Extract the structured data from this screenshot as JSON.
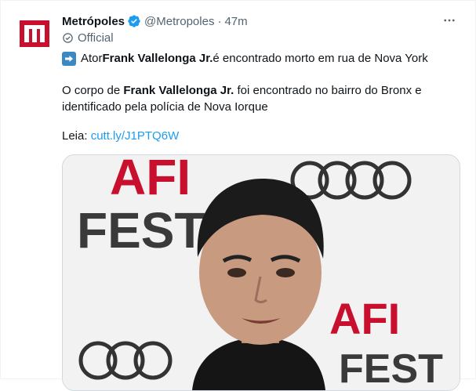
{
  "tweet": {
    "author_name": "Metrópoles",
    "author_handle": "@Metropoles",
    "separator": "·",
    "time": "47m",
    "official_label": "Official",
    "line1": {
      "prefix": "Ator ",
      "bold": "Frank Vallelonga Jr.",
      "suffix": " é encontrado morto em rua de Nova York"
    },
    "para": {
      "prefix": "O corpo de ",
      "bold": "Frank Vallelonga Jr.",
      "suffix": " foi encontrado no bairro do Bronx e identificado pela polícia de Nova Iorque"
    },
    "read_label": "Leia: ",
    "link_text": "cutt.ly/J1PTQ6W",
    "media": {
      "backdrop_text_top": "AFI",
      "backdrop_text_mid": "FEST",
      "backdrop_text_right_top": "AFI",
      "backdrop_text_right_bottom": "FEST"
    }
  },
  "icons": {
    "avatar_logo": "metropoles-m-logo",
    "verified": "verified-badge-icon",
    "more": "more-dots-icon",
    "official": "official-check-icon",
    "arrow": "right-arrow-emoji"
  },
  "colors": {
    "brand_red": "#c8102e",
    "link_blue": "#1d9bf0",
    "verified_blue": "#1d9bf0",
    "muted_text": "#536471",
    "emoji_blue": "#3b88c3"
  }
}
